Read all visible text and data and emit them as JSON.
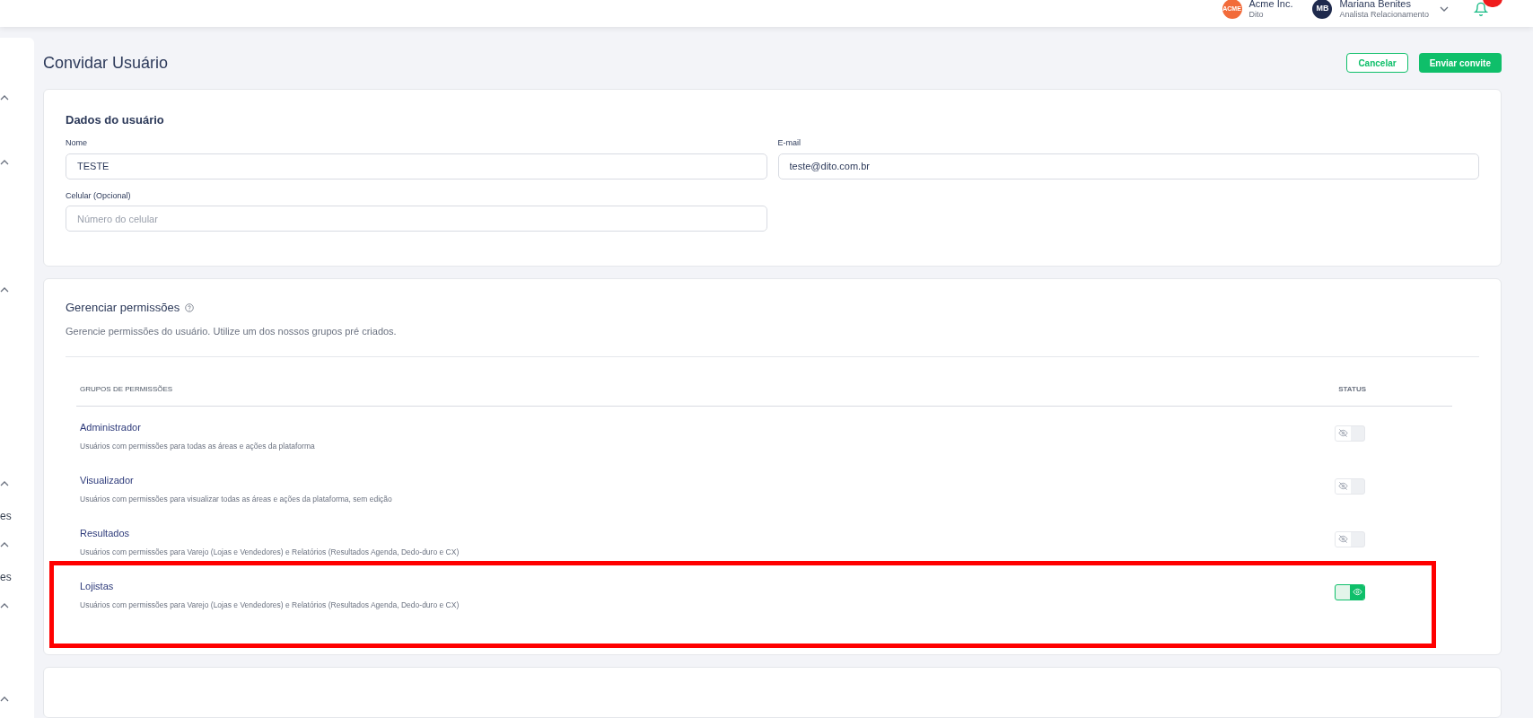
{
  "header": {
    "company": {
      "logo": "ACME",
      "name": "Acme Inc.",
      "sub": "Dito"
    },
    "user": {
      "initials": "MB",
      "name": "Mariana Benites",
      "role": "Analista Relacionamento"
    }
  },
  "sidebar": {
    "items": [
      {
        "kind": "chevron"
      },
      {
        "kind": "chevron"
      },
      {
        "kind": "chevron"
      },
      {
        "kind": "chevron"
      },
      {
        "kind": "label",
        "text": "es"
      },
      {
        "kind": "chevron"
      },
      {
        "kind": "label",
        "text": "es"
      },
      {
        "kind": "chevron"
      },
      {
        "kind": "chevron"
      }
    ]
  },
  "page": {
    "title": "Convidar Usuário",
    "buttons": [
      {
        "kind": "outline",
        "label": "Cancelar"
      },
      {
        "kind": "primary",
        "label": "Enviar convite"
      }
    ]
  },
  "user_data": {
    "title": "Dados do usuário",
    "fields": [
      {
        "label": "Nome",
        "value": "TESTE"
      },
      {
        "label": "E-mail",
        "value": "teste@dito.com.br"
      },
      {
        "label": "Celular (Opcional)",
        "placeholder": "Número do celular"
      }
    ]
  },
  "permissions": {
    "title": "Gerenciar permissões",
    "subtitle": "Gerencie permissões do usuário. Utilize um dos nossos grupos pré criados.",
    "columns": [
      "GRUPOS DE PERMISSÕES",
      "STATUS"
    ],
    "groups": [
      {
        "name": "Administrador",
        "description": "Usuários com permissões para todas as áreas e ações da plataforma",
        "on": false,
        "highlighted": false
      },
      {
        "name": "Visualizador",
        "description": "Usuários com permissões para visualizar todas as áreas e ações da plataforma, sem edição",
        "on": false,
        "highlighted": false
      },
      {
        "name": "Resultados",
        "description": "Usuários com permissões para Varejo (Lojas e Vendedores) e Relatórios (Resultados Agenda, Dedo-duro e CX)",
        "on": false,
        "highlighted": false
      },
      {
        "name": "Lojistas",
        "description": "Usuários com permissões para Varejo (Lojas e Vendedores) e Relatórios (Resultados Agenda, Dedo-duro e CX)",
        "on": true,
        "highlighted": true
      }
    ]
  }
}
